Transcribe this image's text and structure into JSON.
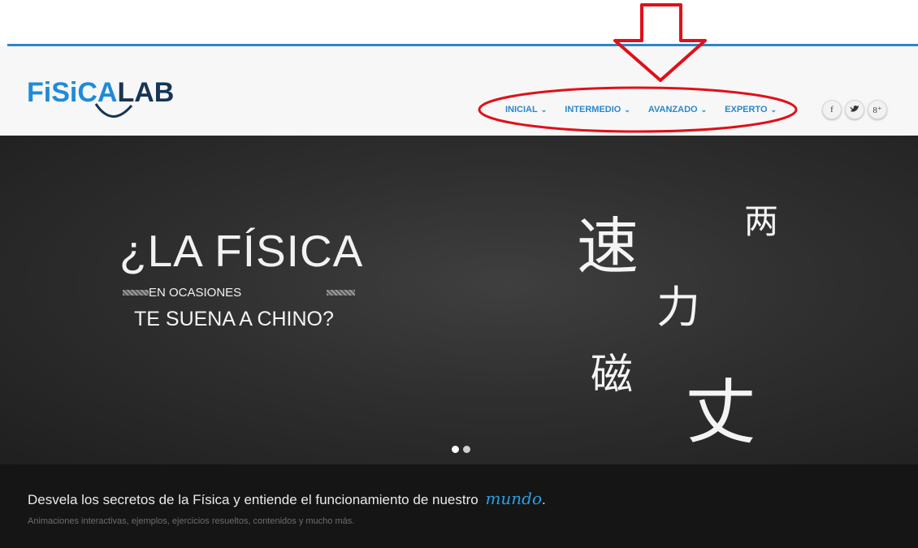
{
  "header": {
    "logo_part1": "FiSiCA",
    "logo_part2": "LAB"
  },
  "nav": {
    "items": [
      {
        "label": "INICIAL"
      },
      {
        "label": "INTERMEDIO"
      },
      {
        "label": "AVANZADO"
      },
      {
        "label": "EXPERTO"
      }
    ]
  },
  "social": {
    "buttons": [
      {
        "icon": "facebook-icon",
        "glyph": "f"
      },
      {
        "icon": "twitter-icon",
        "glyph": "🐦"
      },
      {
        "icon": "google-plus-icon",
        "glyph": "8⁺"
      }
    ]
  },
  "hero": {
    "question_line1": "¿LA FÍSICA",
    "question_sub": "EN OCASIONES",
    "question_line2": "TE SUENA A CHINO?",
    "kanji": [
      "速",
      "两",
      "力",
      "磁",
      "丈"
    ]
  },
  "footer": {
    "tagline_main": "Desvela los secretos de la Física y entiende el funcionamiento de nuestro",
    "tagline_accent": "mundo",
    "tagline_end": ".",
    "subtext": "Animaciones interactivas, ejemplos, ejercicios resueltos, contenidos y mucho más."
  },
  "colors": {
    "brand_blue": "#2a88c9",
    "annotation_red": "#e0101a",
    "accent": "#2a9fe6"
  }
}
